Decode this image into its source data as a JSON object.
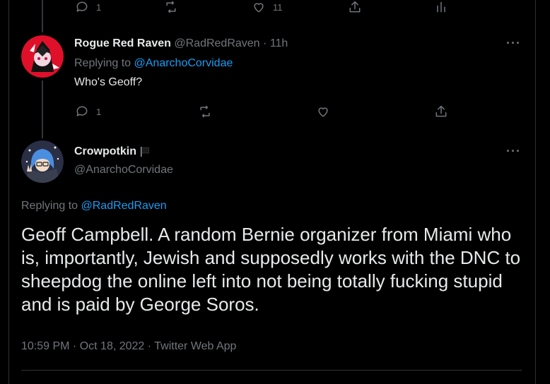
{
  "top_actions": {
    "reply_count": "1",
    "like_count": "11"
  },
  "reply": {
    "display_name": "Rogue Red Raven",
    "handle": "@RadRedRaven",
    "separator": "·",
    "time": "11h",
    "replying_prefix": "Replying to",
    "replying_to": "@AnarchoCorvidae",
    "text": "Who's Geoff?",
    "reply_count": "1"
  },
  "main": {
    "display_name": "Crowpotkin",
    "flag_icon": "black-flag-icon",
    "handle": "@AnarchoCorvidae",
    "replying_prefix": "Replying to",
    "replying_to": "@RadRedRaven",
    "text": "Geoff Campbell. A random Bernie organizer from Miami who is, importantly, Jewish and supposedly works with the DNC to sheepdog the online left into not being totally fucking stupid and is paid by George Soros.",
    "timestamp": "10:59 PM · Oct 18, 2022 · Twitter Web App"
  },
  "more_label": "···",
  "colors": {
    "background": "#000000",
    "text": "#e7e9ea",
    "muted": "#71767b",
    "link": "#1d9bf0",
    "divider": "#2f3336"
  }
}
